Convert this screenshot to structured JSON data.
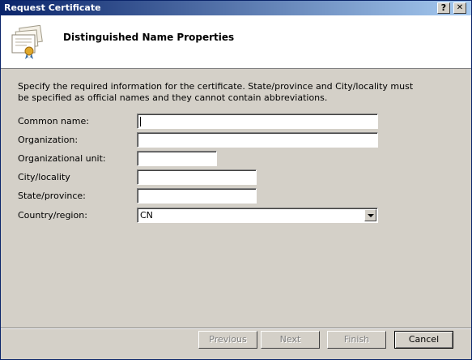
{
  "window": {
    "title": "Request Certificate",
    "help_glyph": "?",
    "close_glyph": "✕"
  },
  "header": {
    "title": "Distinguished Name Properties",
    "icon": "certificate-icon"
  },
  "instructions": "Specify the required information for the certificate. State/province and City/locality must be specified as official names and they cannot contain abbreviations.",
  "form": {
    "common_name": {
      "label": "Common name:",
      "value": ""
    },
    "organization": {
      "label": "Organization:",
      "value": ""
    },
    "organizational_unit": {
      "label": "Organizational unit:",
      "value": ""
    },
    "city": {
      "label": "City/locality",
      "value": ""
    },
    "state": {
      "label": "State/province:",
      "value": ""
    },
    "country": {
      "label": "Country/region:",
      "value": "CN"
    }
  },
  "buttons": {
    "previous": "Previous",
    "next": "Next",
    "finish": "Finish",
    "cancel": "Cancel"
  },
  "colors": {
    "titlebar_start": "#0a246a",
    "titlebar_end": "#a6caf0",
    "dialog_bg": "#d4d0c8"
  }
}
